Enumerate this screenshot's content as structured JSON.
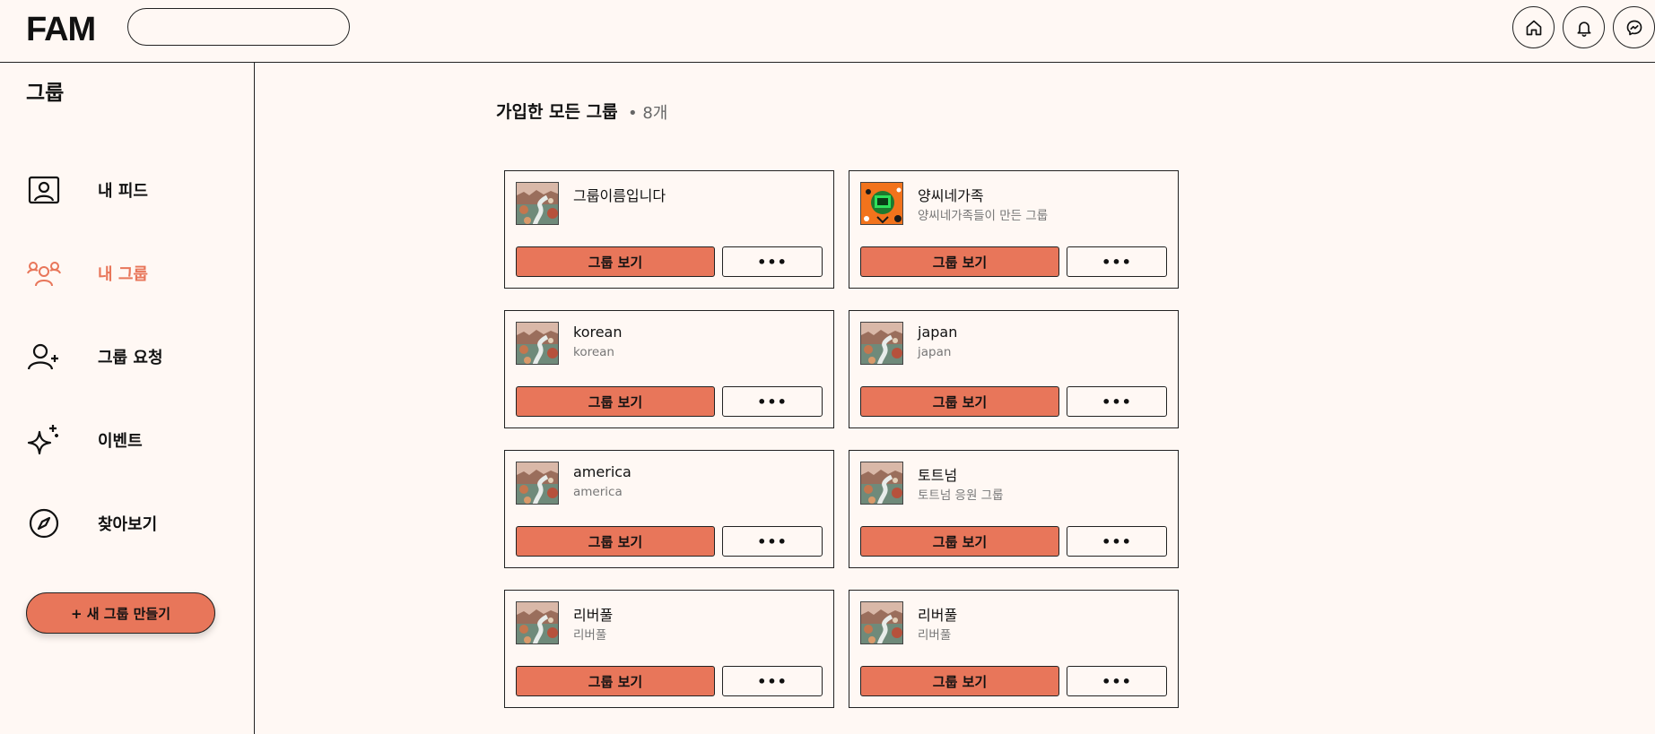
{
  "header": {
    "logo": "FAM",
    "search_placeholder": "",
    "icons": [
      "home-icon",
      "bell-icon",
      "messenger-icon"
    ]
  },
  "sidebar": {
    "title": "그룹",
    "items": [
      {
        "label": "내 피드",
        "icon": "profile-frame-icon",
        "active": false
      },
      {
        "label": "내 그룹",
        "icon": "people-group-icon",
        "active": true
      },
      {
        "label": "그룹 요청",
        "icon": "user-add-icon",
        "active": false
      },
      {
        "label": "이벤트",
        "icon": "sparkle-icon",
        "active": false
      },
      {
        "label": "찾아보기",
        "icon": "compass-icon",
        "active": false
      }
    ],
    "create_button": "+ 새 그룹 만들기"
  },
  "main": {
    "heading": "가입한 모든 그룹",
    "count": "• 8개",
    "view_button_label": "그룹 보기",
    "more_button_label": "•••",
    "groups": [
      {
        "name": "그룹이름입니다",
        "description": "",
        "thumb": "painting"
      },
      {
        "name": "양씨네가족",
        "description": "양씨네가족들이 만든 그룹",
        "thumb": "orange"
      },
      {
        "name": "korean",
        "description": "korean",
        "thumb": "painting"
      },
      {
        "name": "japan",
        "description": "japan",
        "thumb": "painting"
      },
      {
        "name": "america",
        "description": "america",
        "thumb": "painting"
      },
      {
        "name": "토트넘",
        "description": "토트넘 응원 그룹",
        "thumb": "painting"
      },
      {
        "name": "리버풀",
        "description": "리버풀",
        "thumb": "painting"
      },
      {
        "name": "리버풀",
        "description": "리버풀",
        "thumb": "painting"
      }
    ]
  },
  "colors": {
    "accent": "#e8765a",
    "background": "#fff8f4",
    "border": "#222222"
  }
}
